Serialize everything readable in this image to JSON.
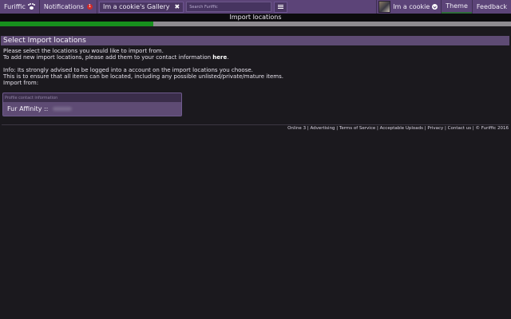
{
  "nav": {
    "brand": "Furiffic",
    "notifications_label": "Notifications",
    "notifications_count": "1",
    "gallery_tab": "Im a cookie's Gallery",
    "search_placeholder": "Search Furiffic",
    "user_name": "Im a cookie",
    "theme_label": "Theme",
    "feedback_label": "Feedback"
  },
  "import_bar": {
    "title": "Import locations",
    "progress": 0.3
  },
  "section": {
    "title": "Select Import locations",
    "line1": "Please select the locations you would like to import from.",
    "line2_pre": "To add new import locations, please add them to your contact information ",
    "line2_link": "here",
    "line2_post": ".",
    "info1": "Info: Its strongly advised to be logged into a account on the import locations you choose.",
    "info2": "This is to ensure that all items can be located, including any possible unlisted/private/mature items.",
    "import_from_label": "Import from:"
  },
  "select": {
    "placeholder": "Profile contact information",
    "option_label": "Fur Affinity ::"
  },
  "footer": {
    "items": [
      "Online 3",
      "Advertising",
      "Terms of Service",
      "Acceptable Uploads",
      "Privacy",
      "Contact us",
      "© Furiffic 2016"
    ]
  }
}
